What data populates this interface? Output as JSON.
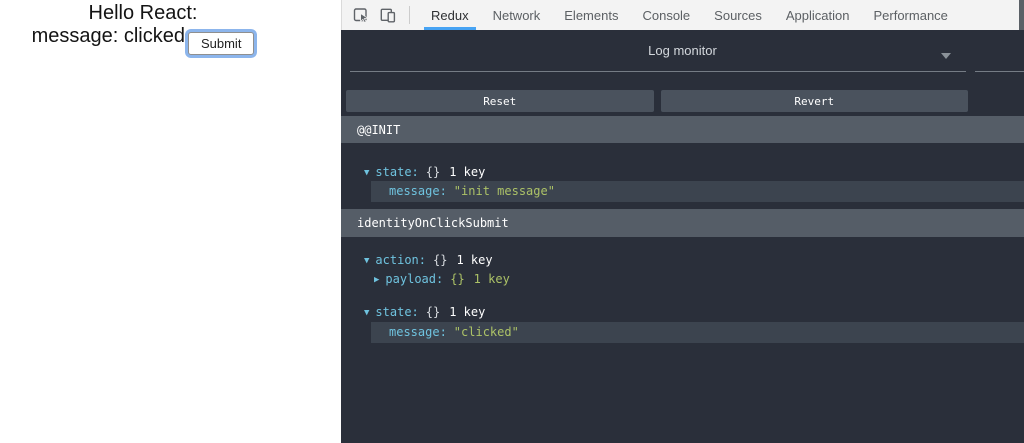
{
  "app": {
    "heading": "Hello React:",
    "message_line": "message: clicked",
    "submit_button": "Submit"
  },
  "devtools": {
    "toolbar": {
      "icons": [
        "inspect-icon",
        "device-toolbar-icon"
      ],
      "tabs": [
        "Redux",
        "Network",
        "Elements",
        "Console",
        "Sources",
        "Application",
        "Performance"
      ],
      "active_tab": "Redux"
    },
    "monitor": {
      "selector_label": "Log monitor",
      "buttons": {
        "reset": "Reset",
        "revert": "Revert"
      },
      "entries": [
        {
          "title": "@@INIT",
          "state": {
            "arrow": "▼",
            "key": "state:",
            "brace": "{}",
            "count": "1 key"
          },
          "message": {
            "key": "message:",
            "value": "\"init message\""
          }
        },
        {
          "title": "identityOnClickSubmit",
          "action": {
            "arrow": "▼",
            "key": "action:",
            "brace": "{}",
            "count": "1 key"
          },
          "payload": {
            "arrow": "▶",
            "key": "payload:",
            "brace": "{}",
            "count": "1 key"
          },
          "state": {
            "arrow": "▼",
            "key": "state:",
            "brace": "{}",
            "count": "1 key"
          },
          "message": {
            "key": "message:",
            "value": "\"clicked\""
          }
        }
      ]
    },
    "colors": {
      "panel_bg": "#2a2f3a",
      "entry_title_bg": "#555d67",
      "button_bg": "#4a525d",
      "highlight_row_bg": "#3c444f",
      "key_color": "#6fc3df",
      "string_color": "#acc267",
      "tab_underline": "#47a3f3",
      "focus_ring": "#8cb5ec"
    }
  }
}
